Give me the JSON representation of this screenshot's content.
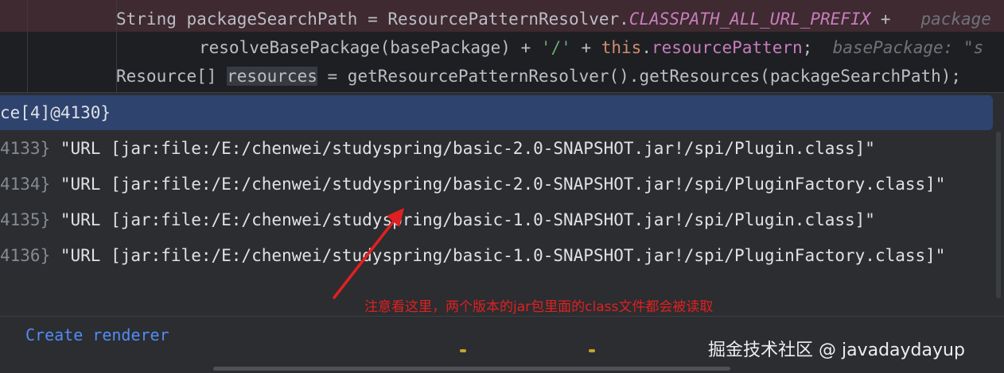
{
  "editor": {
    "line1": {
      "a": "String packageSearchPath = ResourcePatternResolver.",
      "b": "CLASSPATH_ALL_URL_PREFIX",
      "c": " +   ",
      "hint": "package"
    },
    "line2": {
      "a": "resolveBasePackage(basePackage) + ",
      "b": "'/'",
      "c": " + ",
      "d": "this",
      "e": ".",
      "f": "resourcePattern",
      "g": ";  ",
      "hint": "basePackage: \"s"
    },
    "line3": {
      "a": "Resource[] ",
      "b": "resources",
      "c": " = getResourcePatternResolver().getResources(packageSearchPath);"
    }
  },
  "popup": {
    "header": "ce[4]@4130}",
    "items": [
      {
        "id": "4133}",
        "value": " \"URL [jar:file:/E:/chenwei/studyspring/basic-2.0-SNAPSHOT.jar!/spi/Plugin.class]\""
      },
      {
        "id": "4134}",
        "value": " \"URL [jar:file:/E:/chenwei/studyspring/basic-2.0-SNAPSHOT.jar!/spi/PluginFactory.class]\""
      },
      {
        "id": "4135}",
        "value": " \"URL [jar:file:/E:/chenwei/studyspring/basic-1.0-SNAPSHOT.jar!/spi/Plugin.class]\""
      },
      {
        "id": "4136}",
        "value": " \"URL [jar:file:/E:/chenwei/studyspring/basic-1.0-SNAPSHOT.jar!/spi/PluginFactory.class]\""
      }
    ],
    "create_renderer": "Create renderer"
  },
  "annotation": "注意看这里，两个版本的jar包里面的class文件都会被读取",
  "watermark": "掘金技术社区 @ javadaydayup",
  "colors": {
    "annotation": "#e02020",
    "header_bg": "#2e436e",
    "link": "#548af7"
  }
}
